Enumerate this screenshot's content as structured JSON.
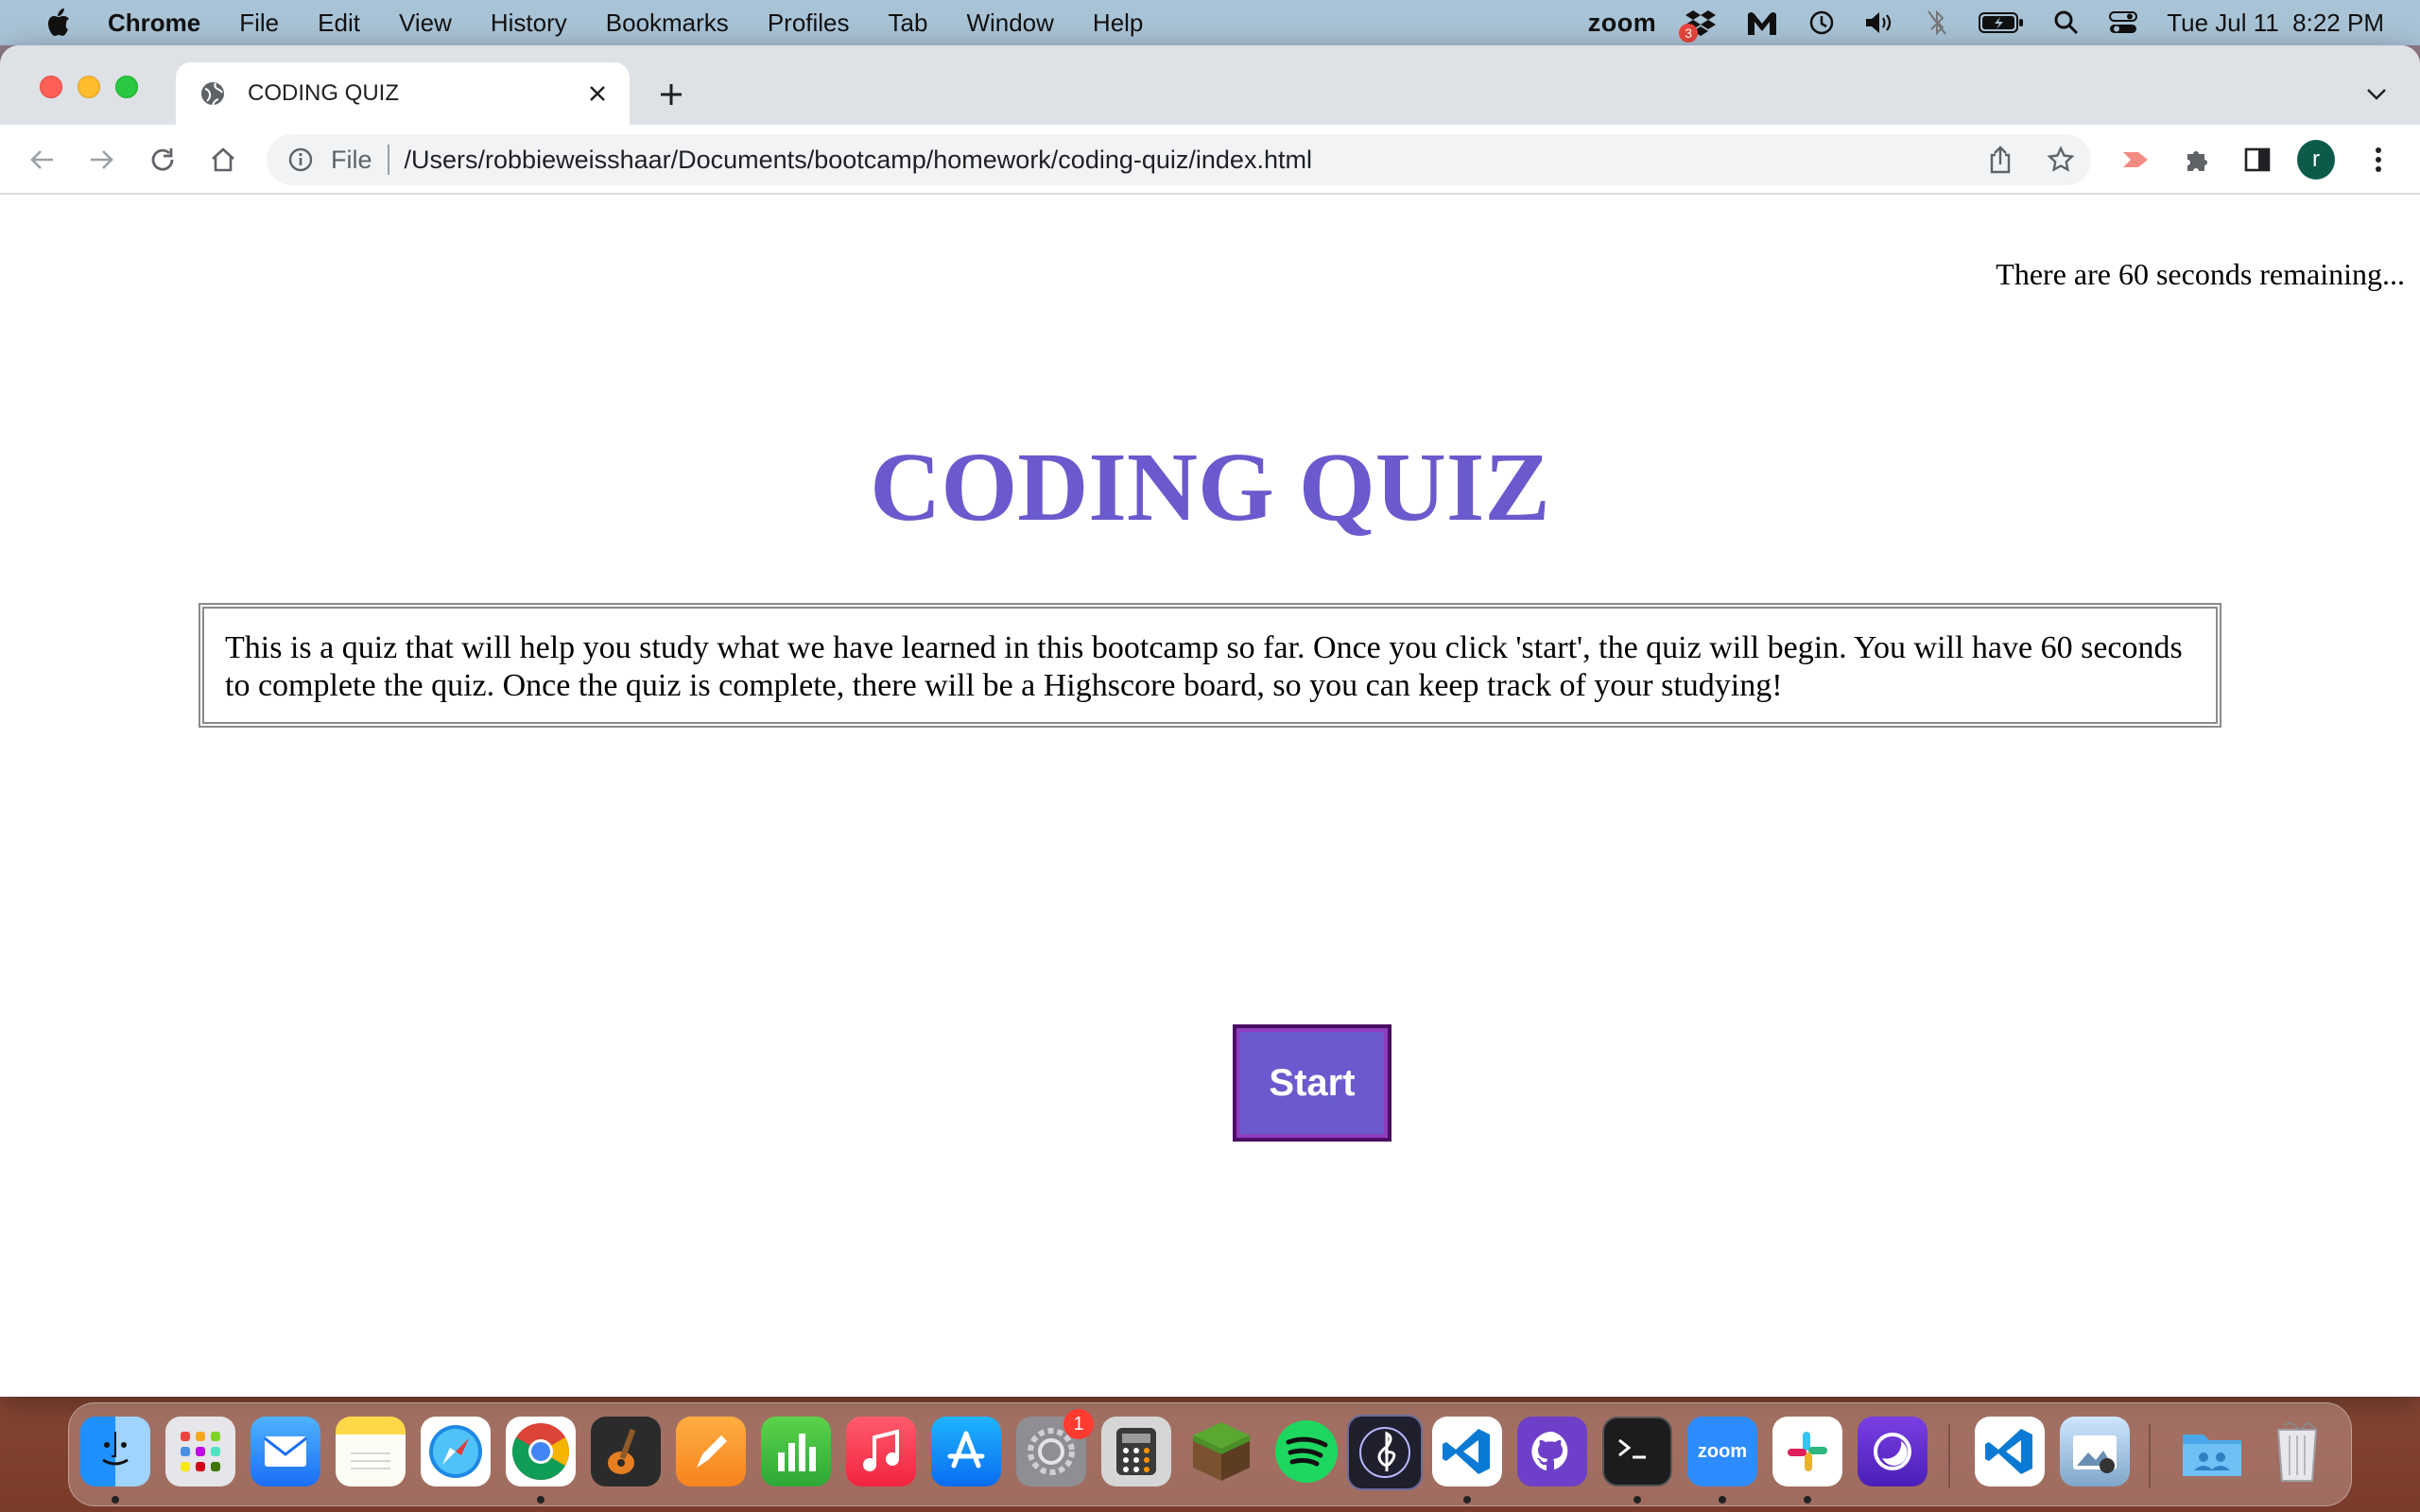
{
  "menubar": {
    "app_name": "Chrome",
    "menus": [
      "File",
      "Edit",
      "View",
      "History",
      "Bookmarks",
      "Profiles",
      "Tab",
      "Window",
      "Help"
    ],
    "status": {
      "zoom_label": "zoom",
      "dropbox_badge": "3",
      "date_time": "Tue Jul 11  8:22 PM"
    }
  },
  "browser": {
    "tab_title": "CODING QUIZ",
    "scheme_label": "File",
    "url": "/Users/robbieweisshaar/Documents/bootcamp/homework/coding-quiz/index.html",
    "profile_initial": "r"
  },
  "page": {
    "timer_text": "There are 60 seconds remaining...",
    "title": "CODING QUIZ",
    "description": "This is a quiz that will help you study what we have learned in this bootcamp so far. Once you click 'start', the quiz will begin. You will have 60 seconds to complete the quiz. Once the quiz is complete, there will be a Highscore board, so you can keep track of your studying!",
    "start_label": "Start"
  },
  "dock": {
    "settings_badge": "1",
    "zoom_label": "zoom"
  },
  "colors": {
    "accent": "#6a5acd",
    "menubar": "#a9c3d6",
    "button_border": "#4b0e63"
  }
}
